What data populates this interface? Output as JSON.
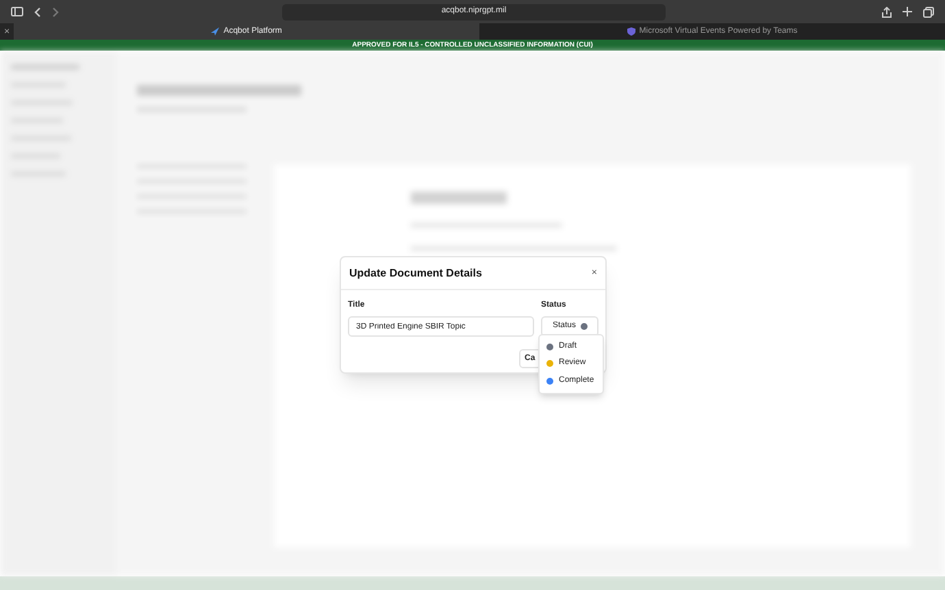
{
  "browser": {
    "address": "acqbot.niprgpt.mil",
    "tab_close": "×",
    "tabs": [
      {
        "label": "Acqbot Platform",
        "selected": true
      },
      {
        "label": "Microsoft Virtual Events Powered by Teams",
        "selected": false
      }
    ]
  },
  "banner": "APPROVED FOR IL5 - CONTROLLED UNCLASSIFIED INFORMATION (CUI)",
  "dialog": {
    "title": "Update Document Details",
    "close": "×",
    "title_label": "Title",
    "title_value": "3D Printed Engine SBIR Topic",
    "status_label": "Status",
    "status_button": "Status",
    "cancel_button": "Ca",
    "status_options": [
      {
        "label": "Draft",
        "color": "#6b7280"
      },
      {
        "label": "Review",
        "color": "#eab308"
      },
      {
        "label": "Complete",
        "color": "#3b82f6"
      }
    ]
  }
}
